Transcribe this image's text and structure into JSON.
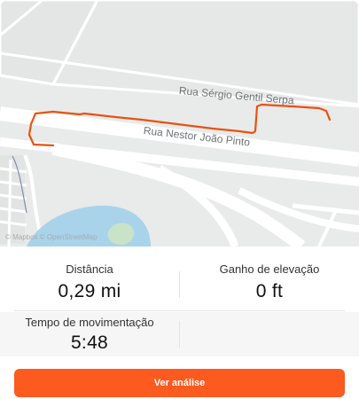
{
  "map": {
    "street_1": "Rua Sérgio Gentil Serpa",
    "street_2": "Rua Nestor João Pinto",
    "attribution": "© Mapbox © OpenStreetMap",
    "route_color": "#e8520f"
  },
  "stats": {
    "distance_label": "Distância",
    "distance_value": "0,29 mi",
    "elevation_label": "Ganho de elevação",
    "elevation_value": "0 ft",
    "moving_time_label": "Tempo de movimentação",
    "moving_time_value": "5:48"
  },
  "actions": {
    "analysis_button": "Ver análise"
  }
}
